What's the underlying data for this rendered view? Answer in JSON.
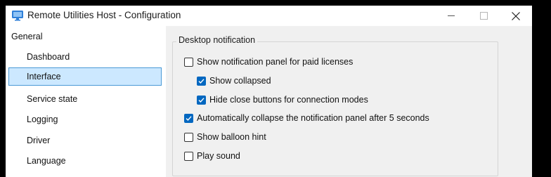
{
  "window": {
    "title": "Remote Utilities Host - Configuration",
    "controls": [
      "minimize",
      "maximize",
      "close"
    ]
  },
  "sidebar": {
    "items": [
      {
        "label": "General",
        "level": 0,
        "selected": false
      },
      {
        "label": "Dashboard",
        "level": 1,
        "selected": false
      },
      {
        "label": "Interface",
        "level": 1,
        "selected": true
      },
      {
        "label": "Service state",
        "level": 1,
        "selected": false
      },
      {
        "label": "Logging",
        "level": 1,
        "selected": false
      },
      {
        "label": "Driver",
        "level": 1,
        "selected": false
      },
      {
        "label": "Language",
        "level": 1,
        "selected": false
      }
    ]
  },
  "panel": {
    "group_title": "Desktop notification",
    "options": [
      {
        "label": "Show notification panel for paid licenses",
        "checked": false
      },
      {
        "label": "Show collapsed",
        "checked": true
      },
      {
        "label": "Hide close buttons for connection modes",
        "checked": true
      },
      {
        "label": "Automatically collapse the notification panel after 5 seconds",
        "checked": true
      },
      {
        "label": "Show balloon hint",
        "checked": false
      },
      {
        "label": "Play sound",
        "checked": false
      }
    ]
  },
  "colors": {
    "accent": "#0067c0",
    "selection_bg": "#cce8ff",
    "selection_border": "#4a9ad6",
    "panel_bg": "#f0f0f0"
  }
}
